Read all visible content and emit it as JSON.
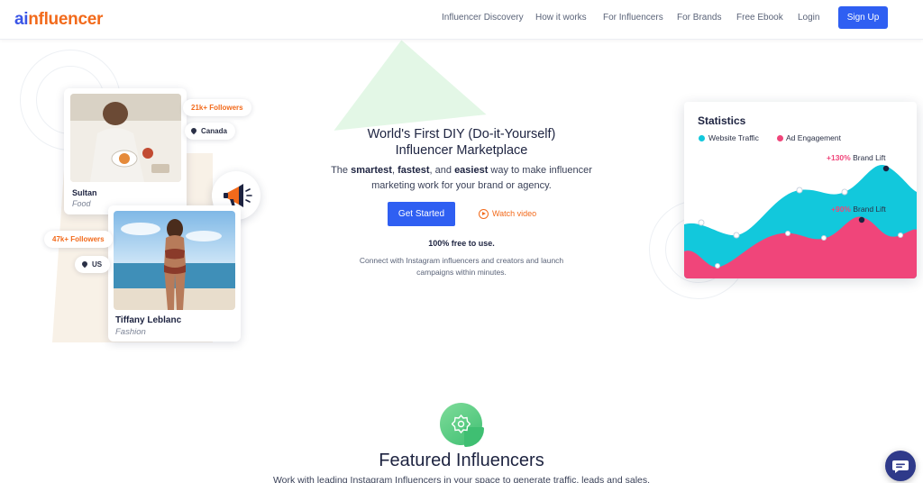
{
  "header": {
    "logo_part1": "ai",
    "logo_part2": "nfluencer",
    "nav": [
      "Influencer Discovery",
      "How it works",
      "For Influencers",
      "For Brands",
      "Free Ebook",
      "Login"
    ],
    "signup_label": "Sign Up"
  },
  "profiles": [
    {
      "name": "Sultan",
      "category": "Food",
      "followers": "21k+ Followers",
      "location": "Canada"
    },
    {
      "name": "Tiffany Leblanc",
      "category": "Fashion",
      "followers": "47k+ Followers",
      "location": "US"
    }
  ],
  "hero": {
    "title_line1": "World's First DIY (Do-it-Yourself)",
    "title_line2": "Influencer Marketplace",
    "sub_w1": "smartest",
    "sub_w2": "fastest",
    "sub_w3": "easiest",
    "sub_t0": "The ",
    "sub_t1": ", ",
    "sub_t2": ", and ",
    "sub_t3": " way to make influencer",
    "sub_line2": "marketing work for your brand or agency.",
    "cta_label": "Get Started",
    "watch_label": "Watch video",
    "free_text": "100% free to use.",
    "connect_line1": "Connect with Instagram influencers and creators and launch",
    "connect_line2": "campaigns within minutes."
  },
  "stats": {
    "title": "Statistics",
    "legend": [
      {
        "label": "Website Traffic",
        "color": "#12c8dc"
      },
      {
        "label": "Ad Engagement",
        "color": "#f0457a"
      }
    ],
    "lift1_value": "+130%",
    "lift1_label": "Brand Lift",
    "lift2_value": "+90%",
    "lift2_label": "Brand Lift"
  },
  "featured": {
    "title": "Featured Influencers",
    "subtitle": "Work with leading Instagram Influencers in your space to generate traffic, leads and sales."
  },
  "colors": {
    "primary": "#2f5ff2",
    "accent": "#f26a1b",
    "traffic": "#12c8dc",
    "engagement": "#f0457a"
  },
  "icons": {
    "megaphone": "megaphone-icon",
    "location": "location-pin-icon",
    "play": "play-icon",
    "featured": "badge-icon",
    "chat": "chat-icon"
  }
}
